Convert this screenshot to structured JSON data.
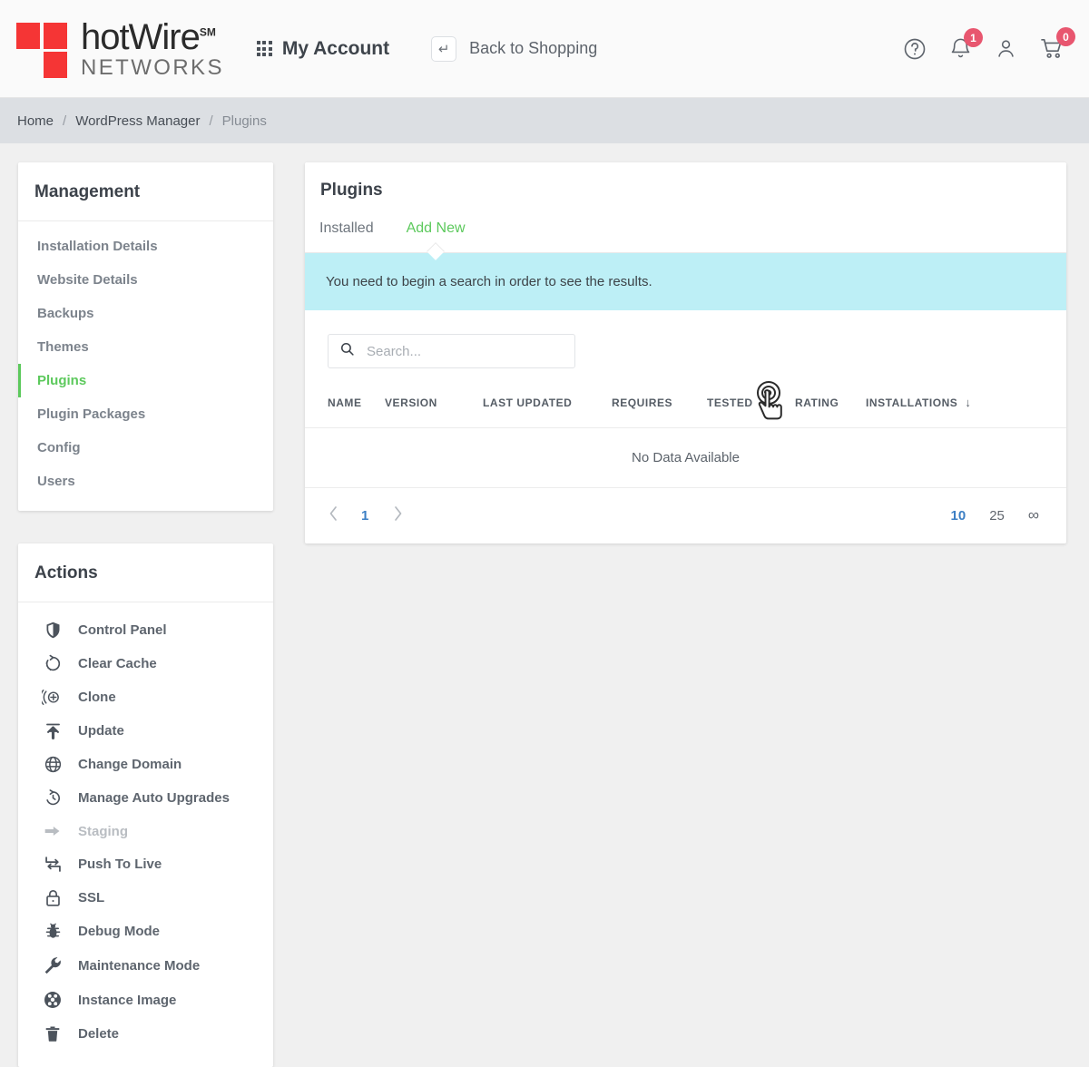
{
  "header": {
    "logo": {
      "name_top": "hotWire",
      "sm": "SM",
      "name_bottom": "NETWORKS"
    },
    "my_account_label": "My Account",
    "back_to_shopping_label": "Back to Shopping",
    "help_icon": "question-circle-icon",
    "notifications_icon": "bell-icon",
    "notifications_badge": "1",
    "user_icon": "user-icon",
    "cart_icon": "shopping-cart-icon",
    "cart_badge": "0"
  },
  "breadcrumb": {
    "items": [
      {
        "label": "Home"
      },
      {
        "label": "WordPress Manager"
      },
      {
        "label": "Plugins"
      }
    ],
    "separator": "/"
  },
  "sidebar": {
    "management": {
      "title": "Management",
      "items": [
        {
          "label": "Installation Details",
          "active": false
        },
        {
          "label": "Website Details",
          "active": false
        },
        {
          "label": "Backups",
          "active": false
        },
        {
          "label": "Themes",
          "active": false
        },
        {
          "label": "Plugins",
          "active": true
        },
        {
          "label": "Plugin Packages",
          "active": false
        },
        {
          "label": "Config",
          "active": false
        },
        {
          "label": "Users",
          "active": false
        }
      ]
    },
    "actions": {
      "title": "Actions",
      "items": [
        {
          "label": "Control Panel",
          "icon": "shield-icon",
          "disabled": false
        },
        {
          "label": "Clear Cache",
          "icon": "refresh-dashed-icon",
          "disabled": false
        },
        {
          "label": "Clone",
          "icon": "clone-plus-icon",
          "disabled": false
        },
        {
          "label": "Update",
          "icon": "upload-arrow-icon",
          "disabled": false
        },
        {
          "label": "Change Domain",
          "icon": "globe-icon",
          "disabled": false
        },
        {
          "label": "Manage Auto Upgrades",
          "icon": "history-clock-icon",
          "disabled": false
        },
        {
          "label": "Staging",
          "icon": "arrow-right-icon",
          "disabled": true
        },
        {
          "label": "Push To Live",
          "icon": "swap-arrows-icon",
          "disabled": false
        },
        {
          "label": "SSL",
          "icon": "lock-icon",
          "disabled": false
        },
        {
          "label": "Debug Mode",
          "icon": "bug-icon",
          "disabled": false
        },
        {
          "label": "Maintenance Mode",
          "icon": "wrench-icon",
          "disabled": false
        },
        {
          "label": "Instance Image",
          "icon": "film-reel-icon",
          "disabled": false
        },
        {
          "label": "Delete",
          "icon": "trash-icon",
          "disabled": false
        }
      ]
    }
  },
  "main": {
    "title": "Plugins",
    "tabs": [
      {
        "label": "Installed",
        "active": false
      },
      {
        "label": "Add New",
        "active": true
      }
    ],
    "notice": "You need to begin a search in order to see the results.",
    "search": {
      "value": "",
      "placeholder": "Search...",
      "icon": "search-icon"
    },
    "table": {
      "columns": [
        "NAME",
        "VERSION",
        "LAST UPDATED",
        "REQUIRES",
        "TESTED",
        "RATING",
        "INSTALLATIONS"
      ],
      "sort_column": "INSTALLATIONS",
      "sort_direction_icon": "arrow-down-icon",
      "rows": [],
      "empty_message": "No Data Available"
    },
    "pagination": {
      "prev_icon": "chevron-left-icon",
      "next_icon": "chevron-right-icon",
      "pages": [
        "1"
      ],
      "current_page": "1",
      "page_sizes": [
        "10",
        "25",
        "∞"
      ],
      "current_page_size": "10"
    },
    "cursor": "pointer-hand-click-icon"
  },
  "colors": {
    "accent_green": "#5cc95c",
    "brand_red": "#f53535",
    "badge_red": "#e8566f",
    "notice_bg": "#bdeff6",
    "link_blue": "#3c7fc4"
  }
}
